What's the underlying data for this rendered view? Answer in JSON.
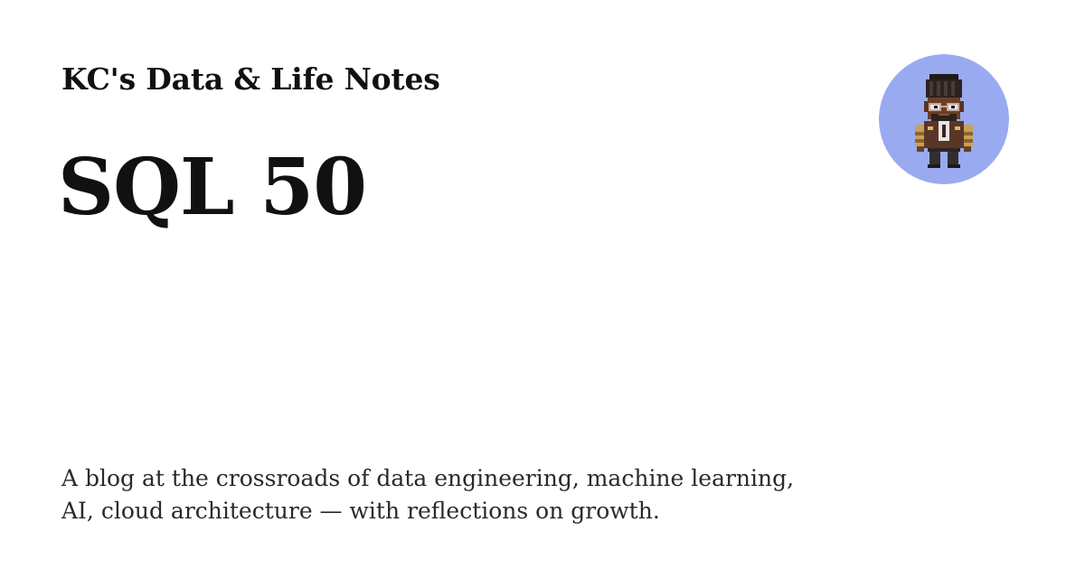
{
  "site": {
    "name": "KC's Data & Life Notes"
  },
  "post": {
    "title": "SQL 50"
  },
  "blog": {
    "description": "A blog at the crossroads of data engineering, machine learning, AI, cloud architecture — with reflections on growth."
  },
  "avatar": {
    "icon": "pixel-art-character-icon",
    "background_color": "#9aaaf0"
  },
  "colors": {
    "text": "#111111",
    "description_text": "#2a2a2a",
    "background": "#ffffff"
  }
}
